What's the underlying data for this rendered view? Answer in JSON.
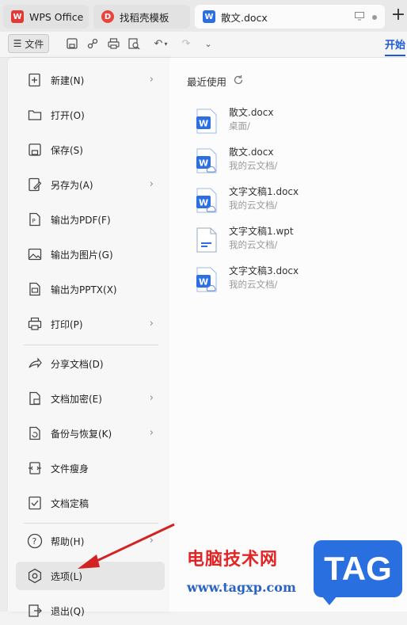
{
  "tabs": [
    {
      "label": "WPS Office",
      "icon": "wps-logo-icon"
    },
    {
      "label": "找稻壳模板",
      "icon": "docer-icon"
    },
    {
      "label": "散文.docx",
      "icon": "word-doc-icon"
    }
  ],
  "toolbar": {
    "file_label": "文件",
    "start_label": "开始"
  },
  "menu": {
    "items": [
      {
        "label": "新建(N)",
        "icon": "new-icon",
        "submenu": true
      },
      {
        "label": "打开(O)",
        "icon": "open-folder-icon",
        "submenu": false
      },
      {
        "label": "保存(S)",
        "icon": "save-icon",
        "submenu": false
      },
      {
        "label": "另存为(A)",
        "icon": "save-as-icon",
        "submenu": true
      },
      {
        "label": "输出为PDF(F)",
        "icon": "export-pdf-icon",
        "submenu": false
      },
      {
        "label": "输出为图片(G)",
        "icon": "export-image-icon",
        "submenu": false
      },
      {
        "label": "输出为PPTX(X)",
        "icon": "export-pptx-icon",
        "submenu": false
      },
      {
        "label": "打印(P)",
        "icon": "print-icon",
        "submenu": true
      },
      {
        "label": "分享文档(D)",
        "icon": "share-icon",
        "submenu": false
      },
      {
        "label": "文档加密(E)",
        "icon": "encrypt-icon",
        "submenu": true
      },
      {
        "label": "备份与恢复(K)",
        "icon": "backup-icon",
        "submenu": true
      },
      {
        "label": "文件瘦身",
        "icon": "slim-icon",
        "submenu": false
      },
      {
        "label": "文档定稿",
        "icon": "finalize-icon",
        "submenu": false
      },
      {
        "label": "帮助(H)",
        "icon": "help-icon",
        "submenu": true
      },
      {
        "label": "选项(L)",
        "icon": "options-icon",
        "submenu": false
      },
      {
        "label": "退出(Q)",
        "icon": "exit-icon",
        "submenu": false
      }
    ]
  },
  "recent": {
    "title": "最近使用",
    "files": [
      {
        "name": "散文.docx",
        "path": "桌面/",
        "type": "word"
      },
      {
        "name": "散文.docx",
        "path": "我的云文档/",
        "type": "word-cloud"
      },
      {
        "name": "文字文稿1.docx",
        "path": "我的云文档/",
        "type": "word-cloud"
      },
      {
        "name": "文字文稿1.wpt",
        "path": "我的云文档/",
        "type": "wpt"
      },
      {
        "name": "文字文稿3.docx",
        "path": "我的云文档/",
        "type": "word-cloud"
      }
    ]
  },
  "watermark": {
    "site_name": "电脑技术网",
    "url": "www.tagxp.com",
    "badge": "TAG"
  },
  "colors": {
    "word_blue": "#2b6fe3",
    "accent_blue": "#1d5ad8",
    "wps_red": "#e53935",
    "annotation_red": "#d32222"
  }
}
